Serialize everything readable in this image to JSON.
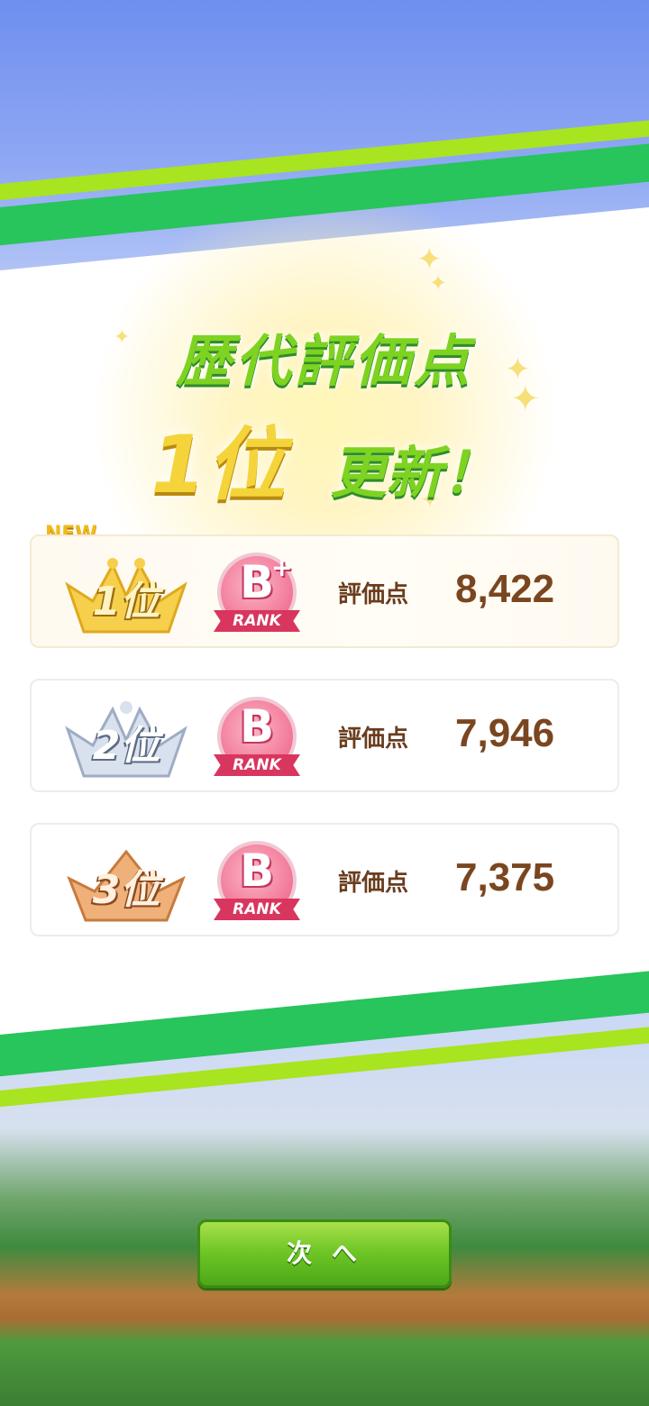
{
  "headline": {
    "line1": "歴代評価点",
    "line2_place": "1位",
    "line2_update": "更新！"
  },
  "new_tag": "NEW",
  "rankings": [
    {
      "place": "1位",
      "rank_letter": "B",
      "rank_plus": "+",
      "rank_word": "RANK",
      "score_label": "評価点",
      "score": "8,422"
    },
    {
      "place": "2位",
      "rank_letter": "B",
      "rank_plus": "",
      "rank_word": "RANK",
      "score_label": "評価点",
      "score": "7,946"
    },
    {
      "place": "3位",
      "rank_letter": "B",
      "rank_plus": "",
      "rank_word": "RANK",
      "score_label": "評価点",
      "score": "7,375"
    }
  ],
  "next_button": "次 へ",
  "colors": {
    "gold": "#f4d43a",
    "silver": "#b8c4d8",
    "bronze": "#e39b5b",
    "green_accent": "#7ed321",
    "score_brown": "#7a4620"
  },
  "icons": [
    "crown-gold-icon",
    "crown-silver-icon",
    "crown-bronze-icon",
    "sparkle-icon"
  ]
}
